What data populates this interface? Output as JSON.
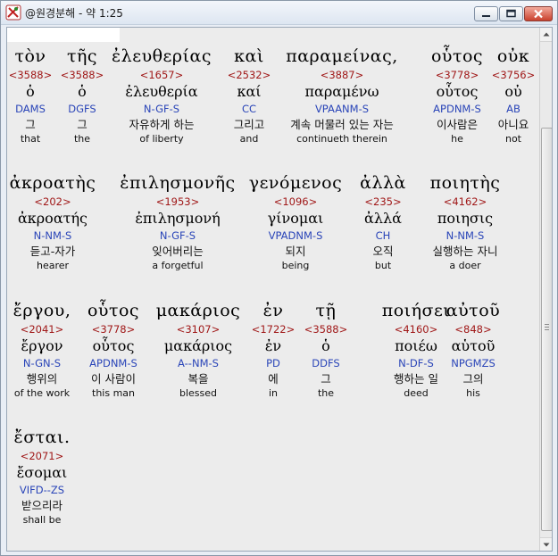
{
  "window": {
    "title": "@원경분해 - 약 1:25",
    "buttons": [
      "minimize",
      "maximize",
      "close"
    ]
  },
  "lines": [
    [
      {
        "greek": "τὸν",
        "strong": "<3588>",
        "lemma": "ὁ",
        "morph": "DAMS",
        "korean": "그",
        "english": "that"
      },
      {
        "greek": "τῆς",
        "strong": "<3588>",
        "lemma": "ὁ",
        "morph": "DGFS",
        "korean": "그",
        "english": "the"
      },
      {
        "greek": "ἐλευθερίας",
        "strong": "<1657>",
        "lemma": "ἐλευθερία",
        "morph": "N-GF-S",
        "korean": "자유하게 하는",
        "english": "of liberty"
      },
      {
        "greek": "καὶ",
        "strong": "<2532>",
        "lemma": "καί",
        "morph": "CC",
        "korean": "그리고",
        "english": "and"
      },
      {
        "greek": "παραμείνας,",
        "strong": "<3887>",
        "lemma": "παραμένω",
        "morph": "VPAANM-S",
        "korean": "계속 머물러 있는 자는",
        "english": "continueth therein"
      },
      {
        "greek": "οὗτος",
        "strong": "<3778>",
        "lemma": "οὗτος",
        "morph": "APDNM-S",
        "korean": "이사람은",
        "english": "he"
      },
      {
        "greek": "οὐκ",
        "strong": "<3756>",
        "lemma": "οὐ",
        "morph": "AB",
        "korean": "아니요",
        "english": "not"
      }
    ],
    [
      {
        "greek": "ἀκροατὴς",
        "strong": "<202>",
        "lemma": "ἀκροατής",
        "morph": "N-NM-S",
        "korean": "듣고-자가",
        "english": "hearer"
      },
      {
        "greek": "ἐπιλησμονῆς",
        "strong": "<1953>",
        "lemma": "ἐπιλησμονή",
        "morph": "N-GF-S",
        "korean": "잊어버리는",
        "english": "a forgetful"
      },
      {
        "greek": "γενόμενος",
        "strong": "<1096>",
        "lemma": "γίνομαι",
        "morph": "VPADNM-S",
        "korean": "되지",
        "english": "being"
      },
      {
        "greek": "ἀλλὰ",
        "strong": "<235>",
        "lemma": "ἀλλά",
        "morph": "CH",
        "korean": "오직",
        "english": "but"
      },
      {
        "greek": "ποιητὴς",
        "strong": "<4162>",
        "lemma": "ποιησις",
        "morph": "N-NM-S",
        "korean": "실행하는 자니",
        "english": "a doer"
      }
    ],
    [
      {
        "greek": "ἔργου,",
        "strong": "<2041>",
        "lemma": "ἔργον",
        "morph": "N-GN-S",
        "korean": "행위의",
        "english": "of the work"
      },
      {
        "greek": "οὗτος",
        "strong": "<3778>",
        "lemma": "οὗτος",
        "morph": "APDNM-S",
        "korean": "이 사람이",
        "english": "this man"
      },
      {
        "greek": "μακάριος",
        "strong": "<3107>",
        "lemma": "μακάριος",
        "morph": "A--NM-S",
        "korean": "복을",
        "english": "blessed"
      },
      {
        "greek": "ἐν",
        "strong": "<1722>",
        "lemma": "ἐν",
        "morph": "PD",
        "korean": "에",
        "english": "in"
      },
      {
        "greek": "τῇ",
        "strong": "<3588>",
        "lemma": "ὁ",
        "morph": "DDFS",
        "korean": "그",
        "english": "the"
      },
      {
        "greek": "ποιήσει",
        "strong": "<4160>",
        "lemma": "ποιέω",
        "morph": "N-DF-S",
        "korean": "행하는 일",
        "english": "deed"
      },
      {
        "greek": "αὐτοῦ",
        "strong": "<848>",
        "lemma": "αὑτοῦ",
        "morph": "NPGMZS",
        "korean": "그의",
        "english": "his"
      }
    ],
    [
      {
        "greek": "ἔσται.",
        "strong": "<2071>",
        "lemma": "ἔσομαι",
        "morph": "VIFD--ZS",
        "korean": "받으리라",
        "english": "shall be"
      }
    ]
  ]
}
